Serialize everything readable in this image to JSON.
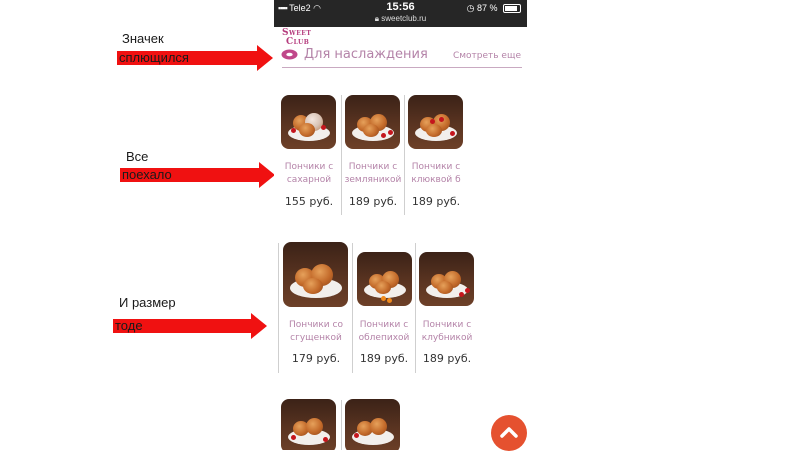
{
  "annotations": [
    {
      "title": "Значек",
      "arrow_text": "сплющился"
    },
    {
      "title": "Все",
      "arrow_text": "поехало"
    },
    {
      "title": "И размер",
      "arrow_text": "тоде"
    }
  ],
  "statusbar": {
    "carrier": "Tele2",
    "time": "15:56",
    "url": "sweetclub.ru",
    "battery": "87 %"
  },
  "logo": {
    "line1": "Sweet",
    "line2": "Club"
  },
  "section": {
    "title": "Для наслаждения",
    "more_link": "Смотреть еще"
  },
  "products": [
    {
      "name_line1": "Пончики с",
      "name_line2": "сахарной",
      "price": "155 руб."
    },
    {
      "name_line1": "Пончики с",
      "name_line2": "земляникой",
      "price": "189 руб."
    },
    {
      "name_line1": "Пончики с",
      "name_line2": "клюквой б",
      "price": "189 руб."
    },
    {
      "name_line1": "Пончики со",
      "name_line2": "сгущенкой",
      "price": "179 руб."
    },
    {
      "name_line1": "Пончики с",
      "name_line2": "облепихой",
      "price": "189 руб."
    },
    {
      "name_line1": "Пончики с",
      "name_line2": "клубникой",
      "price": "189 руб."
    }
  ],
  "icons": {
    "scroll_top": "chevron-up-icon",
    "header": "donut-icon"
  },
  "colors": {
    "accent": "#b483a8",
    "logo": "#b53b7d",
    "arrow": "#f01111",
    "scroll_button": "#e5512f"
  }
}
